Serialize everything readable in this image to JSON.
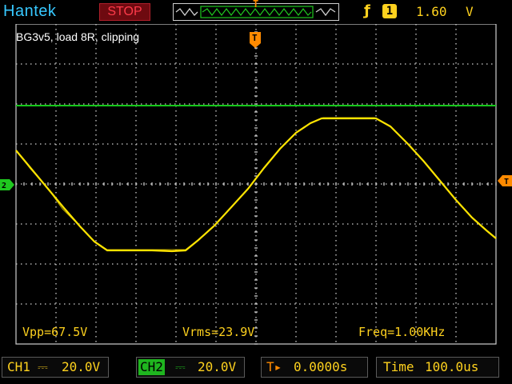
{
  "header": {
    "brand": "Hantek",
    "run_status": "STOP",
    "trigger_marker": "T",
    "trigger_edge_icon": "rising-edge-icon",
    "trigger_source": "1",
    "trigger_level": "1.60",
    "trigger_level_unit": "V"
  },
  "screen": {
    "annotation": "BG3v5, load 8R, clipping",
    "trigger_time_marker": "T",
    "measurements": {
      "vpp": "Vpp=67.5V",
      "vrms": "Vrms=23.9V",
      "freq": "Freq=1.00KHz"
    },
    "colors": {
      "ch1_trace": "#ffe400",
      "ch2_trace": "#16c81b",
      "grid": "#d0d0d0",
      "marker_orange": "#ff8a00"
    }
  },
  "footer": {
    "ch1_label": "CH1",
    "ch1_coupling_icon": "dc-coupling-icon",
    "ch1_scale": "20.0V",
    "ch2_label": "CH2",
    "ch2_coupling_icon": "dc-coupling-icon",
    "ch2_scale": "20.0V",
    "trigger_pos_icon": "trigger-position-icon",
    "trigger_pos": "0.0000s",
    "time_label": "Time",
    "time_value": "100.0us"
  }
}
